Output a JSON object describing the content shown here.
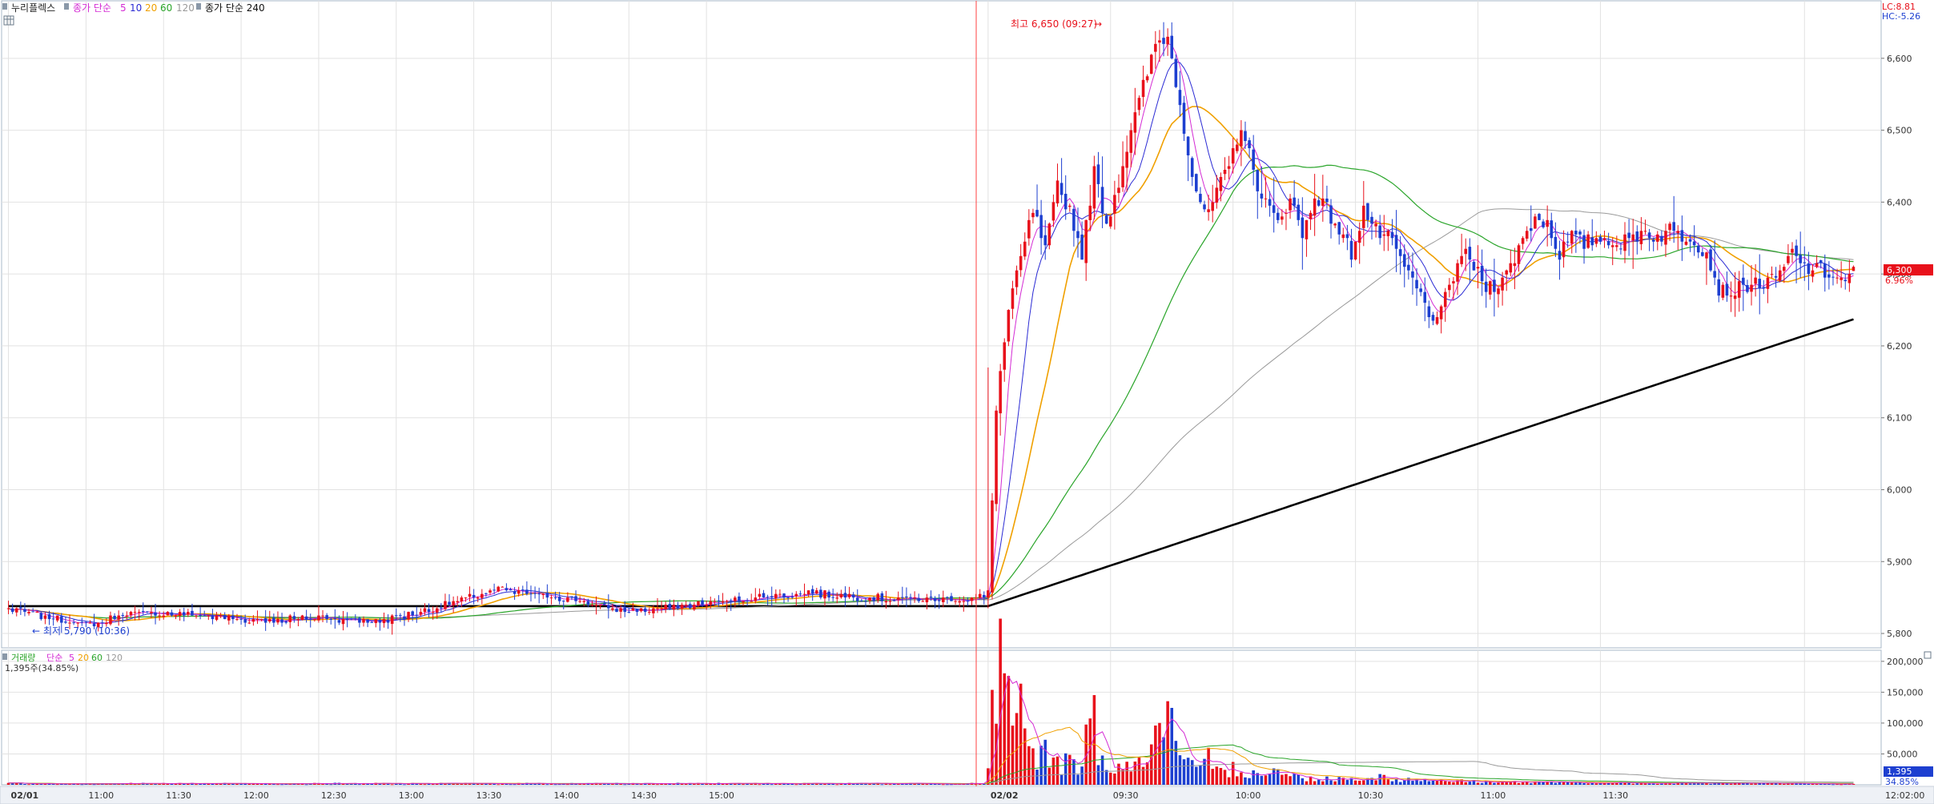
{
  "header": {
    "stock_name": "누리플렉스",
    "price_ma_label": "종가 단순",
    "price_ma_periods": [
      "5",
      "10",
      "20",
      "60",
      "120"
    ],
    "price_ma240_label": "종가 단순 240",
    "volume_label": "거래량",
    "volume_ma_label": "단순",
    "volume_ma_periods": [
      "5",
      "20",
      "60",
      "120"
    ],
    "volume_current": "1,395주(34.85%)",
    "lc_text": "LC:8.81",
    "hc_text": "HC:-5.26"
  },
  "colors": {
    "up": "#e8111b",
    "down": "#1d3fd0",
    "ma5": "#d42bd4",
    "ma10": "#2b2bd4",
    "ma20": "#f0a000",
    "ma60": "#2aa52a",
    "ma120": "#9a9a9a",
    "ma240": "#000000",
    "price_box": "#e8111b",
    "volume_box": "#1d3fd0"
  },
  "chart_data": {
    "type": "candlestick",
    "price_axis": {
      "ticks": [
        "6,600",
        "6,500",
        "6,400",
        "6,300",
        "6,200",
        "6,100",
        "6,000",
        "5,900",
        "5,800"
      ],
      "range": [
        5780,
        6680
      ]
    },
    "volume_axis": {
      "ticks": [
        "200,000",
        "150,000",
        "100,000",
        "50,000"
      ],
      "range": [
        0,
        205000
      ]
    },
    "time_axis": [
      "02/01",
      "11:00",
      "11:30",
      "12:00",
      "12:30",
      "13:00",
      "13:30",
      "14:00",
      "14:30",
      "15:00",
      "02/02",
      "09:30",
      "10:00",
      "10:30",
      "11:00",
      "11:30",
      "12:02:00"
    ],
    "current_price": "6,300",
    "current_change": "6.96%",
    "current_volume": "1,395",
    "current_volume_pct": "34.85%",
    "annotations": {
      "high": "최고 6,650 (09:27)",
      "low": "최저 5,790 (10:36)"
    },
    "series_names": [
      "5",
      "10",
      "20",
      "60",
      "120",
      "240"
    ],
    "price_path": [
      [
        0,
        5835
      ],
      [
        10,
        5822
      ],
      [
        20,
        5812
      ],
      [
        30,
        5830
      ],
      [
        45,
        5826
      ],
      [
        60,
        5818
      ],
      [
        75,
        5822
      ],
      [
        90,
        5817
      ],
      [
        100,
        5828
      ],
      [
        110,
        5845
      ],
      [
        120,
        5862
      ],
      [
        130,
        5852
      ],
      [
        140,
        5846
      ],
      [
        150,
        5830
      ],
      [
        165,
        5838
      ],
      [
        180,
        5848
      ],
      [
        195,
        5857
      ],
      [
        210,
        5850
      ],
      [
        225,
        5846
      ],
      [
        240,
        5851
      ],
      [
        242,
        6120
      ],
      [
        245,
        6250
      ],
      [
        248,
        6320
      ],
      [
        251,
        6390
      ],
      [
        254,
        6330
      ],
      [
        257,
        6420
      ],
      [
        260,
        6390
      ],
      [
        263,
        6330
      ],
      [
        266,
        6440
      ],
      [
        269,
        6370
      ],
      [
        272,
        6430
      ],
      [
        275,
        6500
      ],
      [
        278,
        6560
      ],
      [
        281,
        6620
      ],
      [
        284,
        6630
      ],
      [
        287,
        6540
      ],
      [
        290,
        6440
      ],
      [
        293,
        6380
      ],
      [
        296,
        6410
      ],
      [
        299,
        6450
      ],
      [
        302,
        6510
      ],
      [
        305,
        6440
      ],
      [
        308,
        6400
      ],
      [
        311,
        6370
      ],
      [
        314,
        6410
      ],
      [
        317,
        6350
      ],
      [
        320,
        6410
      ],
      [
        323,
        6390
      ],
      [
        326,
        6360
      ],
      [
        329,
        6330
      ],
      [
        332,
        6390
      ],
      [
        335,
        6360
      ],
      [
        338,
        6350
      ],
      [
        341,
        6320
      ],
      [
        344,
        6290
      ],
      [
        347,
        6260
      ],
      [
        350,
        6230
      ],
      [
        353,
        6280
      ],
      [
        356,
        6330
      ],
      [
        359,
        6310
      ],
      [
        362,
        6280
      ],
      [
        365,
        6290
      ],
      [
        368,
        6310
      ],
      [
        371,
        6350
      ],
      [
        374,
        6380
      ],
      [
        377,
        6370
      ],
      [
        380,
        6330
      ],
      [
        383,
        6350
      ],
      [
        386,
        6340
      ],
      [
        389,
        6350
      ],
      [
        392,
        6350
      ],
      [
        395,
        6340
      ],
      [
        398,
        6350
      ],
      [
        401,
        6360
      ],
      [
        404,
        6350
      ],
      [
        407,
        6360
      ],
      [
        410,
        6355
      ],
      [
        413,
        6350
      ],
      [
        416,
        6330
      ],
      [
        419,
        6280
      ],
      [
        422,
        6275
      ],
      [
        425,
        6280
      ],
      [
        428,
        6290
      ],
      [
        431,
        6285
      ],
      [
        434,
        6300
      ],
      [
        437,
        6330
      ],
      [
        440,
        6310
      ],
      [
        443,
        6305
      ],
      [
        446,
        6300
      ],
      [
        449,
        6290
      ],
      [
        452,
        6300
      ]
    ],
    "volume_profile": [
      [
        240,
        40000
      ],
      [
        241,
        120000
      ],
      [
        242,
        185000
      ],
      [
        243,
        200000
      ],
      [
        244,
        170000
      ],
      [
        245,
        150000
      ],
      [
        246,
        110000
      ],
      [
        247,
        95000
      ],
      [
        248,
        130000
      ],
      [
        249,
        80000
      ],
      [
        250,
        60000
      ],
      [
        252,
        50000
      ],
      [
        254,
        70000
      ],
      [
        256,
        40000
      ],
      [
        258,
        35000
      ],
      [
        260,
        45000
      ],
      [
        262,
        30000
      ],
      [
        264,
        80000
      ],
      [
        265,
        110000
      ],
      [
        266,
        160000
      ],
      [
        267,
        60000
      ],
      [
        268,
        40000
      ],
      [
        270,
        30000
      ],
      [
        272,
        35000
      ],
      [
        274,
        30000
      ],
      [
        276,
        50000
      ],
      [
        278,
        40000
      ],
      [
        280,
        60000
      ],
      [
        282,
        90000
      ],
      [
        284,
        175000
      ],
      [
        285,
        120000
      ],
      [
        286,
        60000
      ],
      [
        288,
        40000
      ],
      [
        290,
        30000
      ],
      [
        292,
        25000
      ],
      [
        294,
        45000
      ],
      [
        296,
        25000
      ],
      [
        298,
        20000
      ],
      [
        300,
        30000
      ],
      [
        302,
        25000
      ],
      [
        304,
        20000
      ],
      [
        306,
        30000
      ],
      [
        308,
        20000
      ],
      [
        310,
        25000
      ],
      [
        315,
        15000
      ],
      [
        320,
        10000
      ],
      [
        325,
        12000
      ],
      [
        330,
        10000
      ],
      [
        335,
        15000
      ],
      [
        340,
        10000
      ],
      [
        350,
        8000
      ],
      [
        360,
        6000
      ],
      [
        370,
        5000
      ],
      [
        380,
        4000
      ],
      [
        400,
        3000
      ],
      [
        420,
        3000
      ],
      [
        452,
        1395
      ]
    ]
  }
}
